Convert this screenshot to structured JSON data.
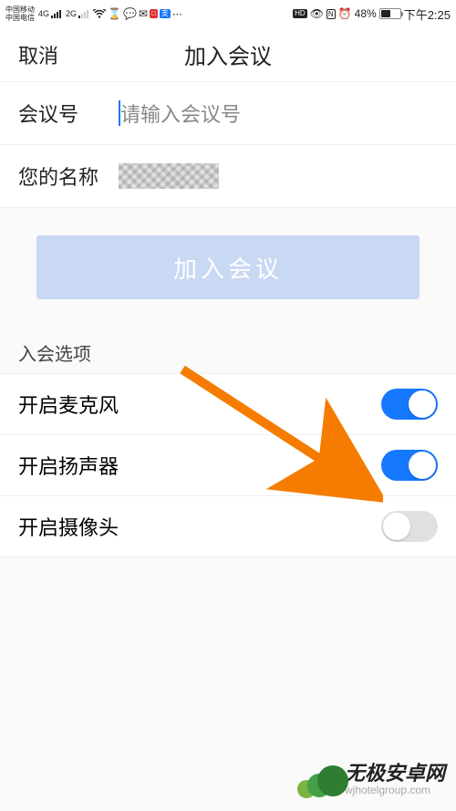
{
  "status": {
    "carrier1": "中国移动",
    "carrier2": "中国电信",
    "net": "4G",
    "net2": "2G",
    "battery_pct": "48%",
    "time": "下午2:25"
  },
  "header": {
    "cancel": "取消",
    "title": "加入会议"
  },
  "form": {
    "meeting_id_label": "会议号",
    "meeting_id_placeholder": "请输入会议号",
    "meeting_id_value": "",
    "name_label": "您的名称"
  },
  "join_button": "加入会议",
  "options": {
    "section_title": "入会选项",
    "items": [
      {
        "label": "开启麦克风",
        "on": true
      },
      {
        "label": "开启扬声器",
        "on": true
      },
      {
        "label": "开启摄像头",
        "on": false
      }
    ]
  },
  "watermark": {
    "main": "无极安卓网",
    "sub": "wjhotelgroup.com"
  }
}
